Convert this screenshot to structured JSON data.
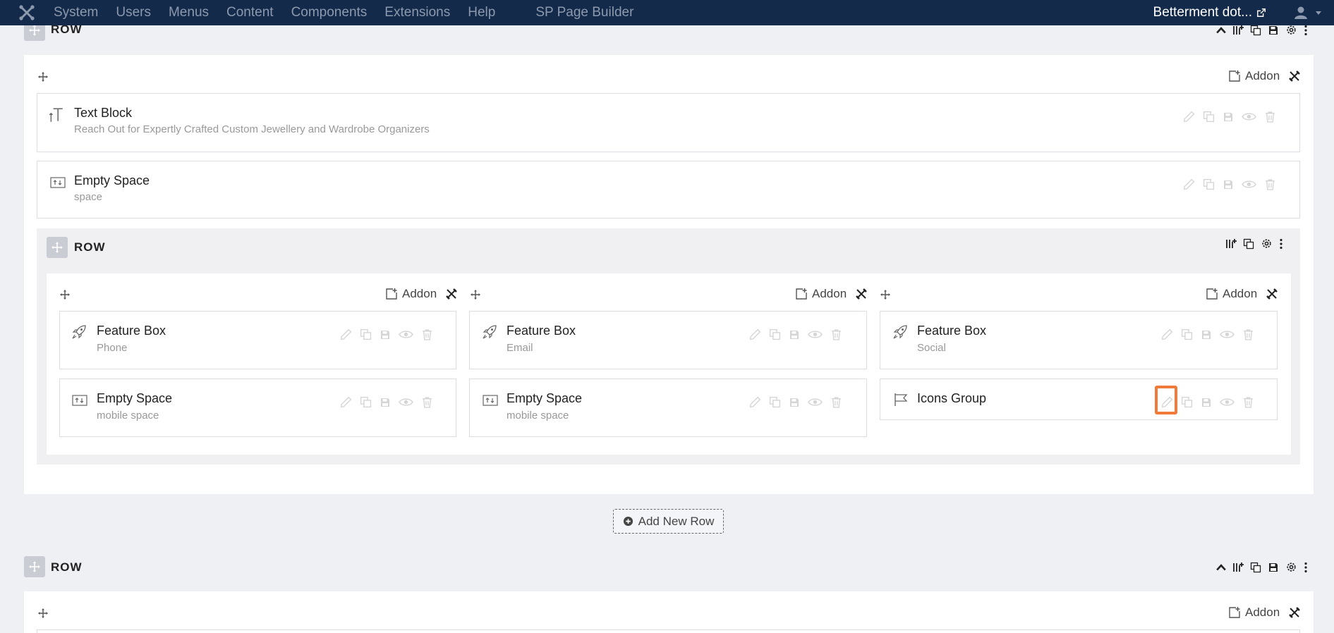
{
  "topbar": {
    "menu": [
      "System",
      "Users",
      "Menus",
      "Content",
      "Components",
      "Extensions",
      "Help",
      "SP Page Builder"
    ],
    "site_name": "Betterment dot...",
    "icons": [
      "joomla-logo",
      "external-link-icon",
      "user-icon",
      "caret-down-icon"
    ]
  },
  "rows": {
    "row_top": {
      "label": "ROW"
    },
    "row_nested": {
      "label": "ROW"
    },
    "row_bottom": {
      "label": "ROW"
    }
  },
  "addon_label": "Addon",
  "addons": {
    "text_block": {
      "title": "Text Block",
      "subtitle": "Reach Out for Expertly Crafted Custom Jewellery and Wardrobe Organizers"
    },
    "empty_space_1": {
      "title": "Empty Space",
      "subtitle": "space"
    },
    "col1": [
      {
        "title": "Feature Box",
        "subtitle": "Phone"
      },
      {
        "title": "Empty Space",
        "subtitle": "mobile space"
      }
    ],
    "col2": [
      {
        "title": "Feature Box",
        "subtitle": "Email"
      },
      {
        "title": "Empty Space",
        "subtitle": "mobile space"
      }
    ],
    "col3": [
      {
        "title": "Feature Box",
        "subtitle": "Social"
      },
      {
        "title": "Icons Group",
        "subtitle": ""
      }
    ]
  },
  "add_new_row": "Add New Row",
  "colors": {
    "topbar": "#132a4a",
    "highlight": "#f07a3a",
    "background": "#eff0f4"
  }
}
